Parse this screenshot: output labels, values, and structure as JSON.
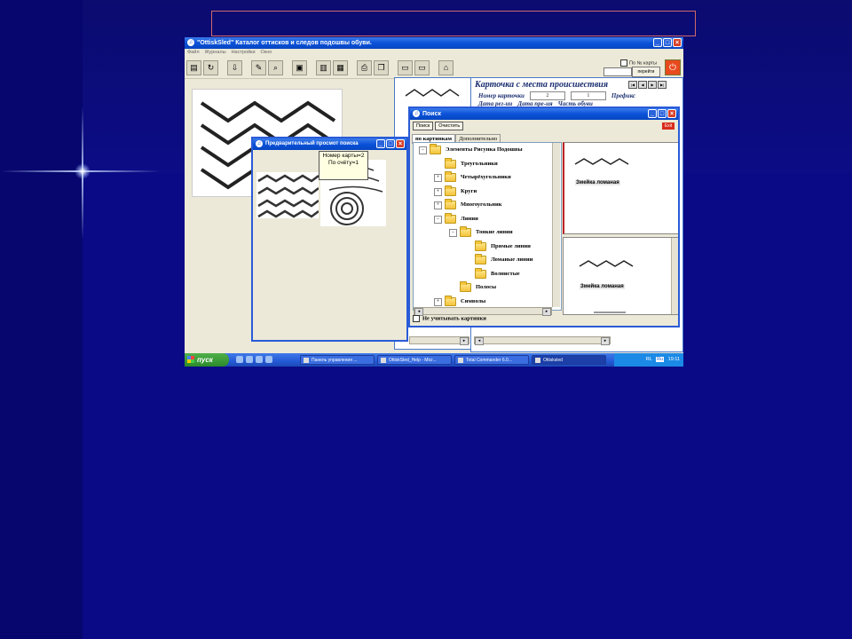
{
  "app": {
    "title": "\"OttiskSled\"   Каталог оттисков и следов  подошвы обуви.",
    "menu": [
      "Файл",
      "Журналы",
      "Настройки",
      "Окно"
    ],
    "card_number_checkbox": "По № карты",
    "goto_button": "перейти",
    "card_panel": {
      "title": "Карточка с места происшествия",
      "row1_label": "Номер карточки",
      "row1_value1": "2",
      "row1_value2": "1",
      "row1_prefix": "Префикс",
      "row2_label1": "Дата рег-ии",
      "row2_label2": "Дата пре-ия",
      "row2_label3": "Часть обуви"
    }
  },
  "preview": {
    "title": "Предварительный просмот поиска",
    "tooltip": "Номер карты=2  По счёту=1"
  },
  "search": {
    "title": "Поиск",
    "buttons": {
      "search": "Поиск",
      "clear": "Очистить",
      "exit": "Exit"
    },
    "tabs": [
      "по картинкам",
      "Дополнительно"
    ],
    "tree": [
      {
        "label": "Элементы Рисунка Подошвы",
        "level": 0,
        "expander": "−"
      },
      {
        "label": "Треугольники",
        "level": 1,
        "expander": ""
      },
      {
        "label": "Четырёхугольники",
        "level": 1,
        "expander": "+"
      },
      {
        "label": "Круги",
        "level": 1,
        "expander": "+"
      },
      {
        "label": "Многоугольник",
        "level": 1,
        "expander": "+"
      },
      {
        "label": "Линии",
        "level": 1,
        "expander": "−"
      },
      {
        "label": "Тонкие линии",
        "level": 2,
        "expander": "−"
      },
      {
        "label": "Прямые линии",
        "level": 3,
        "expander": ""
      },
      {
        "label": "Ломаные линии",
        "level": 3,
        "expander": ""
      },
      {
        "label": "Волнистые",
        "level": 3,
        "expander": ""
      },
      {
        "label": "Полосы",
        "level": 2,
        "expander": ""
      },
      {
        "label": "Символы",
        "level": 1,
        "expander": "+"
      }
    ],
    "pane_top_label": "Змейка ломаная",
    "pane_bottom_label": "Змейка ломаная",
    "ignore_pictures": "Не учитывать картинки"
  },
  "taskbar": {
    "start": "пуск",
    "tasks": [
      "Панель управления ...",
      "OttiskSled_Help - Micr...",
      "Total Commander 6.0...",
      "Ottisksled"
    ],
    "lang": "RL",
    "kbd": "Ru",
    "time": "19:11"
  }
}
